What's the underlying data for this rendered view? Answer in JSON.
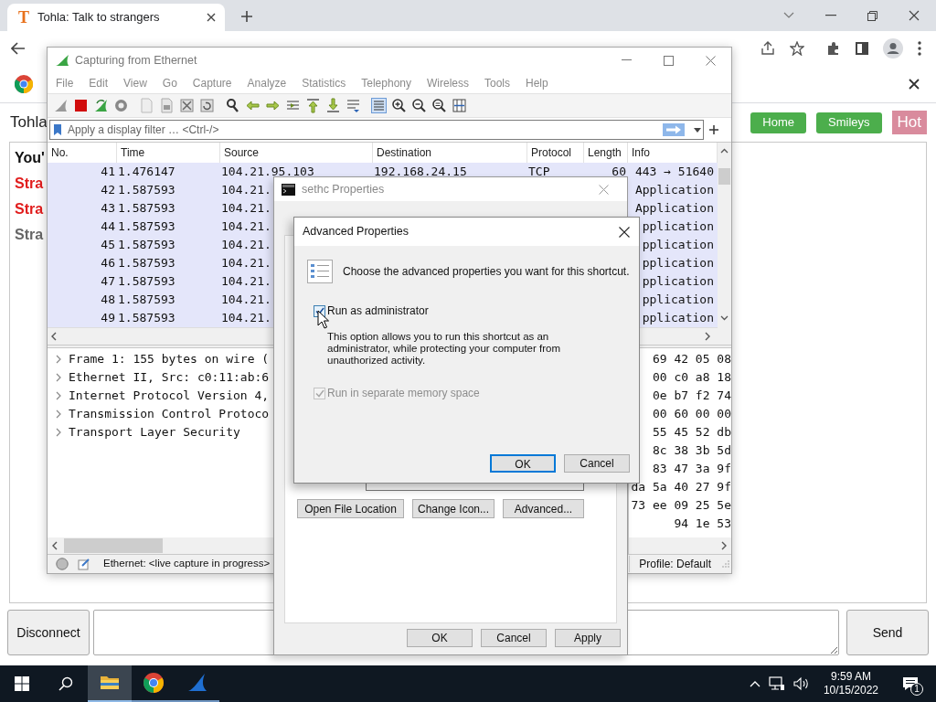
{
  "browser": {
    "favicon": "T",
    "tab_title": "Tohla: Talk to strangers",
    "page": {
      "site_title": "Tohla",
      "nav": [
        {
          "label": "Home",
          "kind": "button"
        },
        {
          "label": "Smileys",
          "kind": "button"
        },
        {
          "label": "Hot",
          "kind": "highlight"
        }
      ],
      "messages": [
        {
          "text": "You'",
          "kind": "notice"
        },
        {
          "text": "Stra",
          "kind": "stranger"
        },
        {
          "text": "Stra",
          "kind": "stranger"
        },
        {
          "text": "Stra",
          "kind": "left"
        }
      ],
      "disconnect_button": "Disconnect",
      "send_button": "Send"
    }
  },
  "wireshark": {
    "title": "Capturing from Ethernet",
    "menu": [
      "File",
      "Edit",
      "View",
      "Go",
      "Capture",
      "Analyze",
      "Statistics",
      "Telephony",
      "Wireless",
      "Tools",
      "Help"
    ],
    "filter_placeholder": "Apply a display filter … <Ctrl-/>",
    "columns": [
      "No.",
      "Time",
      "Source",
      "Destination",
      "Protocol",
      "Length",
      "Info"
    ],
    "packets": [
      {
        "no": "41",
        "time": "1.476147",
        "source": "104.21.95.103",
        "destination": "192.168.24.15",
        "protocol": "TCP",
        "length": "60",
        "info": "443 → 51640"
      },
      {
        "no": "42",
        "time": "1.587593",
        "source": "104.21.",
        "info": "Application"
      },
      {
        "no": "43",
        "time": "1.587593",
        "source": "104.21.",
        "info": "Application"
      },
      {
        "no": "44",
        "time": "1.587593",
        "source": "104.21.",
        "info": "pplication"
      },
      {
        "no": "45",
        "time": "1.587593",
        "source": "104.21.",
        "info": "pplication"
      },
      {
        "no": "46",
        "time": "1.587593",
        "source": "104.21.",
        "info": "pplication"
      },
      {
        "no": "47",
        "time": "1.587593",
        "source": "104.21.",
        "info": "pplication"
      },
      {
        "no": "48",
        "time": "1.587593",
        "source": "104.21.",
        "info": "pplication"
      },
      {
        "no": "49",
        "time": "1.587593",
        "source": "104.21.",
        "info": "pplication"
      }
    ],
    "details": [
      "Frame 1: 155 bytes on wire (",
      "Ethernet II, Src: c0:11:ab:6",
      "Internet Protocol Version 4,",
      "Transmission Control Protoco",
      "Transport Layer Security"
    ],
    "bytes": [
      "69 42 05 08",
      "00 c0 a8 18",
      "0e b7 f2 74",
      "00 60 00 00",
      "55 45 52 db",
      "8c 38 3b 5d",
      "83 47 3a 9f",
      "da 5a 40 27 9f",
      "73 ee 09 25 5e",
      "94 1e 53"
    ],
    "status": "Ethernet: <live capture in progress>",
    "profile": "Profile: Default"
  },
  "properties_dialog": {
    "title": "sethc Properties",
    "buttons": [
      "Open File Location",
      "Change Icon...",
      "Advanced..."
    ],
    "footer_buttons": [
      "OK",
      "Cancel",
      "Apply"
    ]
  },
  "advanced_dialog": {
    "title": "Advanced Properties",
    "prompt": "Choose the advanced properties you want for this shortcut.",
    "options": [
      {
        "label": "Run as administrator",
        "checked": true,
        "disabled": false,
        "description": "This option allows you to run this shortcut as an administrator, while protecting your computer from unauthorized activity."
      },
      {
        "label": "Run in separate memory space",
        "checked": true,
        "disabled": true
      }
    ],
    "buttons": [
      {
        "label": "OK",
        "default": true
      },
      {
        "label": "Cancel",
        "default": false
      }
    ]
  },
  "taskbar": {
    "apps": [
      {
        "kind": "explorer",
        "selected": true
      },
      {
        "kind": "chrome",
        "selected": false
      },
      {
        "kind": "wireshark",
        "selected": false
      }
    ],
    "time": "9:59 AM",
    "date": "10/15/2022",
    "notification_count": "1"
  }
}
